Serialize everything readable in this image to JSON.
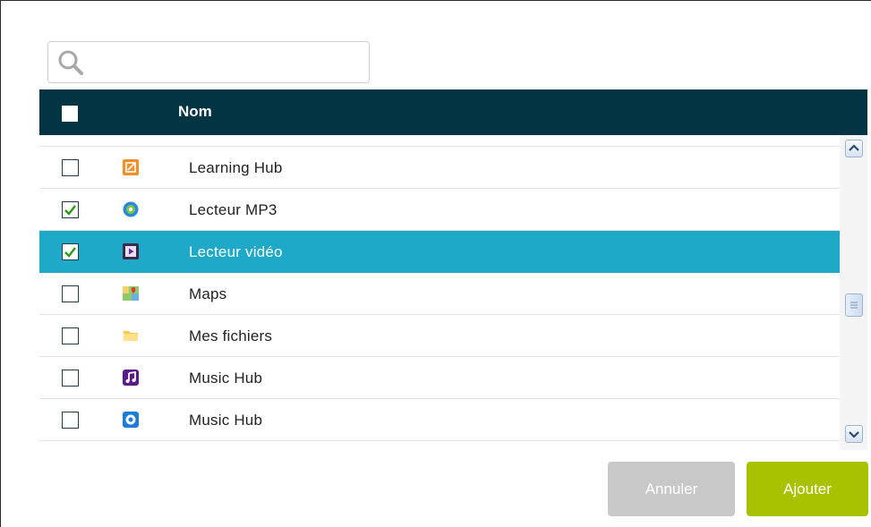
{
  "search": {
    "placeholder": "",
    "value": ""
  },
  "header": {
    "name_label": "Nom"
  },
  "rows": [
    {
      "label": "",
      "checked": false,
      "icon": "red-app-icon"
    },
    {
      "label": "Learning Hub",
      "checked": false,
      "icon": "learning-hub-icon"
    },
    {
      "label": "Lecteur MP3",
      "checked": true,
      "icon": "music-player-icon"
    },
    {
      "label": "Lecteur vidéo",
      "checked": true,
      "selected": true,
      "icon": "video-player-icon"
    },
    {
      "label": "Maps",
      "checked": false,
      "icon": "maps-icon"
    },
    {
      "label": "Mes fichiers",
      "checked": false,
      "icon": "folder-icon"
    },
    {
      "label": "Music Hub",
      "checked": false,
      "icon": "music-hub-icon"
    },
    {
      "label": "Music Hub",
      "checked": false,
      "icon": "music-hub-alt-icon"
    }
  ],
  "buttons": {
    "cancel": "Annuler",
    "add": "Ajouter"
  },
  "colors": {
    "header_bg": "#023444",
    "selected_row": "#1ea9c8",
    "add_button": "#a9c200",
    "cancel_button": "#c8c8c8"
  }
}
